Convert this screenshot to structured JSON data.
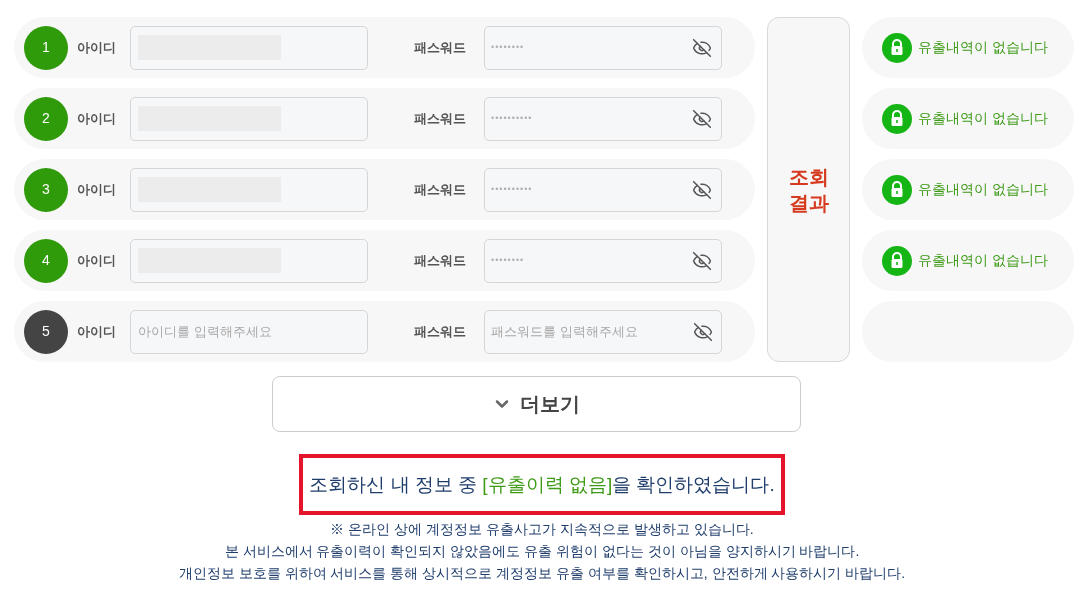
{
  "rows": [
    {
      "number": "1",
      "color": "#2f9a0a",
      "id_label": "아이디",
      "id_redacted": true,
      "password_label": "패스워드",
      "password": "••••••••"
    },
    {
      "number": "2",
      "color": "#2f9a0a",
      "id_label": "아이디",
      "id_redacted": true,
      "password_label": "패스워드",
      "password": "••••••••••"
    },
    {
      "number": "3",
      "color": "#2f9a0a",
      "id_label": "아이디",
      "id_redacted": true,
      "password_label": "패스워드",
      "password": "••••••••••"
    },
    {
      "number": "4",
      "color": "#2f9a0a",
      "id_label": "아이디",
      "id_redacted": true,
      "password_label": "패스워드",
      "password": "••••••••"
    },
    {
      "number": "5",
      "color": "#444444",
      "id_label": "아이디",
      "id_redacted": false,
      "id_placeholder": "아이디를 입력해주세요",
      "password_label": "패스워드",
      "password_placeholder": "패스워드를 입력해주세요"
    }
  ],
  "results_header": "조회 결과",
  "results": [
    {
      "kind": "no-leak",
      "text": "유출내역이 없습니다"
    },
    {
      "kind": "no-leak",
      "text": "유출내역이 없습니다"
    },
    {
      "kind": "no-leak",
      "text": "유출내역이 없습니다"
    },
    {
      "kind": "no-leak",
      "text": "유출내역이 없습니다"
    },
    {
      "kind": "empty"
    }
  ],
  "more_button": "더보기",
  "result_message": {
    "before": "조회하신 내 정보 중",
    "highlight": "[유출이력 없음]",
    "after": "을 확인하였습니다."
  },
  "notices": [
    "※ 온라인 상에 계정정보 유출사고가 지속적으로 발생하고 있습니다.",
    "본 서비스에서 유출이력이 확인되지 않았음에도 유출 위험이 없다는 것이 아님을 양지하시기 바랍니다.",
    "개인정보 보호를 위하여 서비스를 통해 상시적으로 계정정보 유출 여부를 확인하시고, 안전하게 사용하시기 바랍니다."
  ]
}
